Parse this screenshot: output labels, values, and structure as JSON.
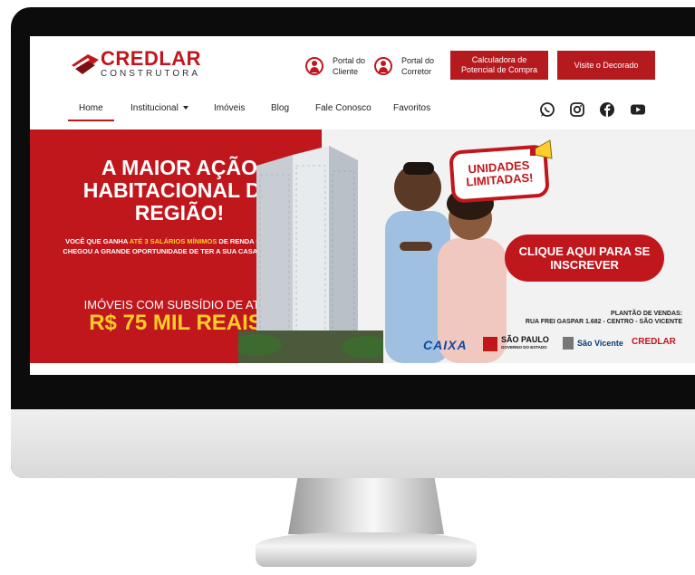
{
  "header": {
    "logo_text": "CREDLAR",
    "logo_sub": "CONSTRUTORA",
    "portal_cliente": "Portal do Cliente",
    "portal_corretor": "Portal do Corretor",
    "btn_calculadora": "Calculadora de Potencial de Compra",
    "btn_decorado": "Visite o Decorado"
  },
  "nav": {
    "items": [
      "Home",
      "Institucional",
      "Imóveis",
      "Blog",
      "Fale Conosco",
      "Favoritos"
    ],
    "active": "Home"
  },
  "social": [
    "whatsapp-icon",
    "instagram-icon",
    "facebook-icon",
    "youtube-icon"
  ],
  "banner": {
    "headline": "A MAIOR AÇÃO HABITACIONAL DA REGIÃO!",
    "text_1": "VOCÊ QUE GANHA ",
    "text_highlight": "ATÉ 3 SALÁRIOS MÍNIMOS",
    "text_2": " DE RENDA FAMILIAR, CHEGOU A GRANDE OPORTUNIDADE DE TER A SUA CASA PRÓPRIA!",
    "subsidy_label": "IMÓVEIS COM SUBSÍDIO DE ATÉ",
    "subsidy_value": "R$ 75 MIL REAIS",
    "unidades": "UNIDADES LIMITADAS!",
    "cta": "CLIQUE AQUI PARA SE INSCREVER",
    "plantao_title": "PLANTÃO DE VENDAS:",
    "plantao_address": "RUA FREI GASPAR 1.682 - CENTRO - SÃO VICENTE",
    "logo_caixa": "CAIXA",
    "logo_sp": "SÃO PAULO",
    "logo_sp_sub": "GOVERNO DO ESTADO",
    "logo_sv": "São Vicente",
    "logo_credlar": "CREDLAR"
  },
  "colors": {
    "brand_red": "#c0171d",
    "highlight_yellow": "#ffcc2a"
  }
}
